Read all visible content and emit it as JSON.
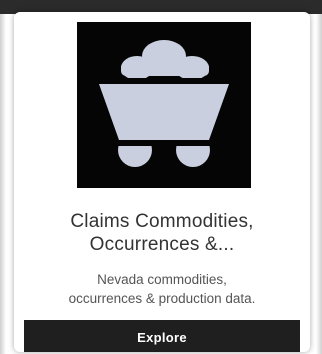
{
  "card": {
    "icon": "mine-cart-icon",
    "title": "Claims Commodities,\nOccurrences &...",
    "description": "Nevada commodities,\noccurrences & production data.",
    "button_label": "Explore"
  },
  "colors": {
    "icon_background": "#050505",
    "icon_fill": "#c9cfdf",
    "button_background": "#1f1f1f",
    "title_text": "#333333"
  }
}
